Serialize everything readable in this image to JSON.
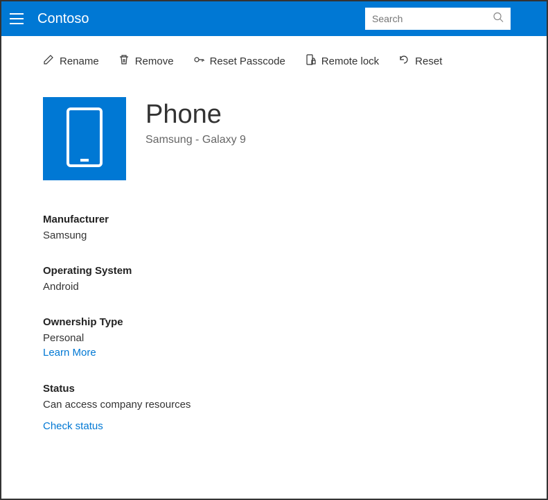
{
  "header": {
    "brand": "Contoso",
    "search_placeholder": "Search"
  },
  "toolbar": {
    "rename": "Rename",
    "remove": "Remove",
    "reset_passcode": "Reset Passcode",
    "remote_lock": "Remote lock",
    "reset": "Reset"
  },
  "device": {
    "title": "Phone",
    "subtitle": "Samsung - Galaxy 9"
  },
  "details": {
    "manufacturer_label": "Manufacturer",
    "manufacturer_value": "Samsung",
    "os_label": "Operating System",
    "os_value": "Android",
    "ownership_label": "Ownership Type",
    "ownership_value": "Personal",
    "learn_more": "Learn More",
    "status_label": "Status",
    "status_value": "Can access company resources",
    "check_status": "Check status"
  }
}
